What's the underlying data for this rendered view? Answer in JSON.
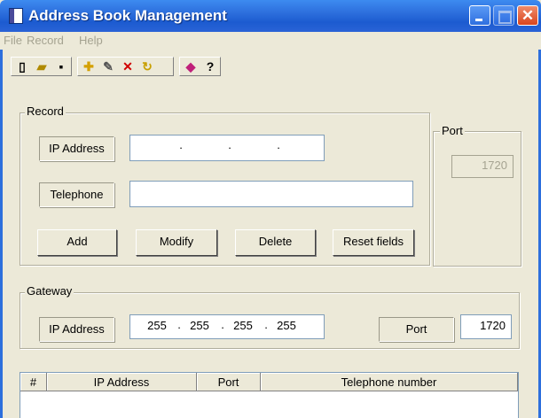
{
  "window": {
    "title": "Address Book Management"
  },
  "menu": [
    "File",
    "Record",
    "Help"
  ],
  "toolbar": [
    {
      "icon": "new-icon",
      "glyph": "▯"
    },
    {
      "icon": "open-icon",
      "glyph": "📂"
    },
    {
      "icon": "save-icon",
      "glyph": "▪"
    },
    {
      "icon": "add-record-icon",
      "glyph": "✚"
    },
    {
      "icon": "edit-icon",
      "glyph": "✎"
    },
    {
      "icon": "delete-icon",
      "glyph": "✕"
    },
    {
      "icon": "reset-icon",
      "glyph": "↻"
    },
    {
      "icon": "book-icon",
      "glyph": "◆"
    },
    {
      "icon": "help-icon",
      "glyph": "?"
    }
  ],
  "record": {
    "group_label": "Record",
    "ip_label": "IP Address",
    "ip_value": [
      ".",
      ".",
      "."
    ],
    "telephone_label": "Telephone",
    "telephone_value": "",
    "buttons": {
      "add": "Add",
      "modify": "Modify",
      "delete": "Delete",
      "reset": "Reset fields"
    },
    "port_group_label": "Port",
    "port_value": "1720"
  },
  "gateway": {
    "group_label": "Gateway",
    "ip_label": "IP Address",
    "ip": [
      "255",
      "255",
      "255",
      "255"
    ],
    "port_label": "Port",
    "port_value": "1720"
  },
  "list": {
    "columns": [
      "#",
      "IP Address",
      "Port",
      "Telephone number"
    ]
  },
  "colors": {
    "title_bar": "#2d6fdd",
    "face": "#ece9d8",
    "close": "#d9451e"
  }
}
